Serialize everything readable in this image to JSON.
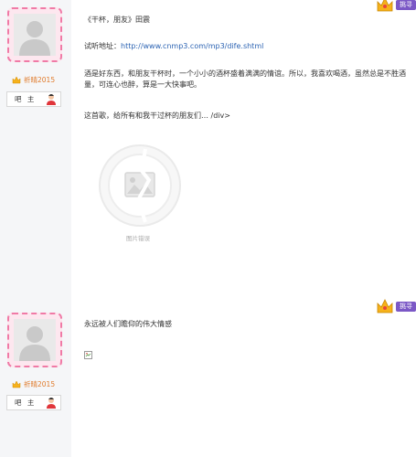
{
  "posts": [
    {
      "user": {
        "name": "祈晴2015",
        "role_label": "吧 主"
      },
      "gift_button": "挑寻",
      "song_title": "《干杯，朋友》田震",
      "listen_label": "试听地址：",
      "listen_url": "http://www.cnmp3.com/mp3/dife.shtml",
      "paragraph": "酒是好东西，和朋友干杯时，一个小小的酒杯盛着满满的情谊。所以，我喜欢喝酒，虽然总是不胜酒量，可连心也醉，算是一大快事吧。",
      "closing": "这首歌，给所有和我干过杯的朋友们… /div>",
      "image_error_caption": "图片错误"
    },
    {
      "user": {
        "name": "祈晴2015",
        "role_label": "吧 主"
      },
      "gift_button": "挑寻",
      "text": "永远被人们瞻仰的伟大情感"
    }
  ],
  "colors": {
    "accent_pink": "#f07aa6",
    "link": "#2d64b3",
    "gift_purple": "#7b58c6",
    "username": "#e07a2a"
  },
  "icons": [
    "default-avatar-icon",
    "crown-icon",
    "manager-person-icon",
    "image-error-icon",
    "broken-image-icon"
  ]
}
